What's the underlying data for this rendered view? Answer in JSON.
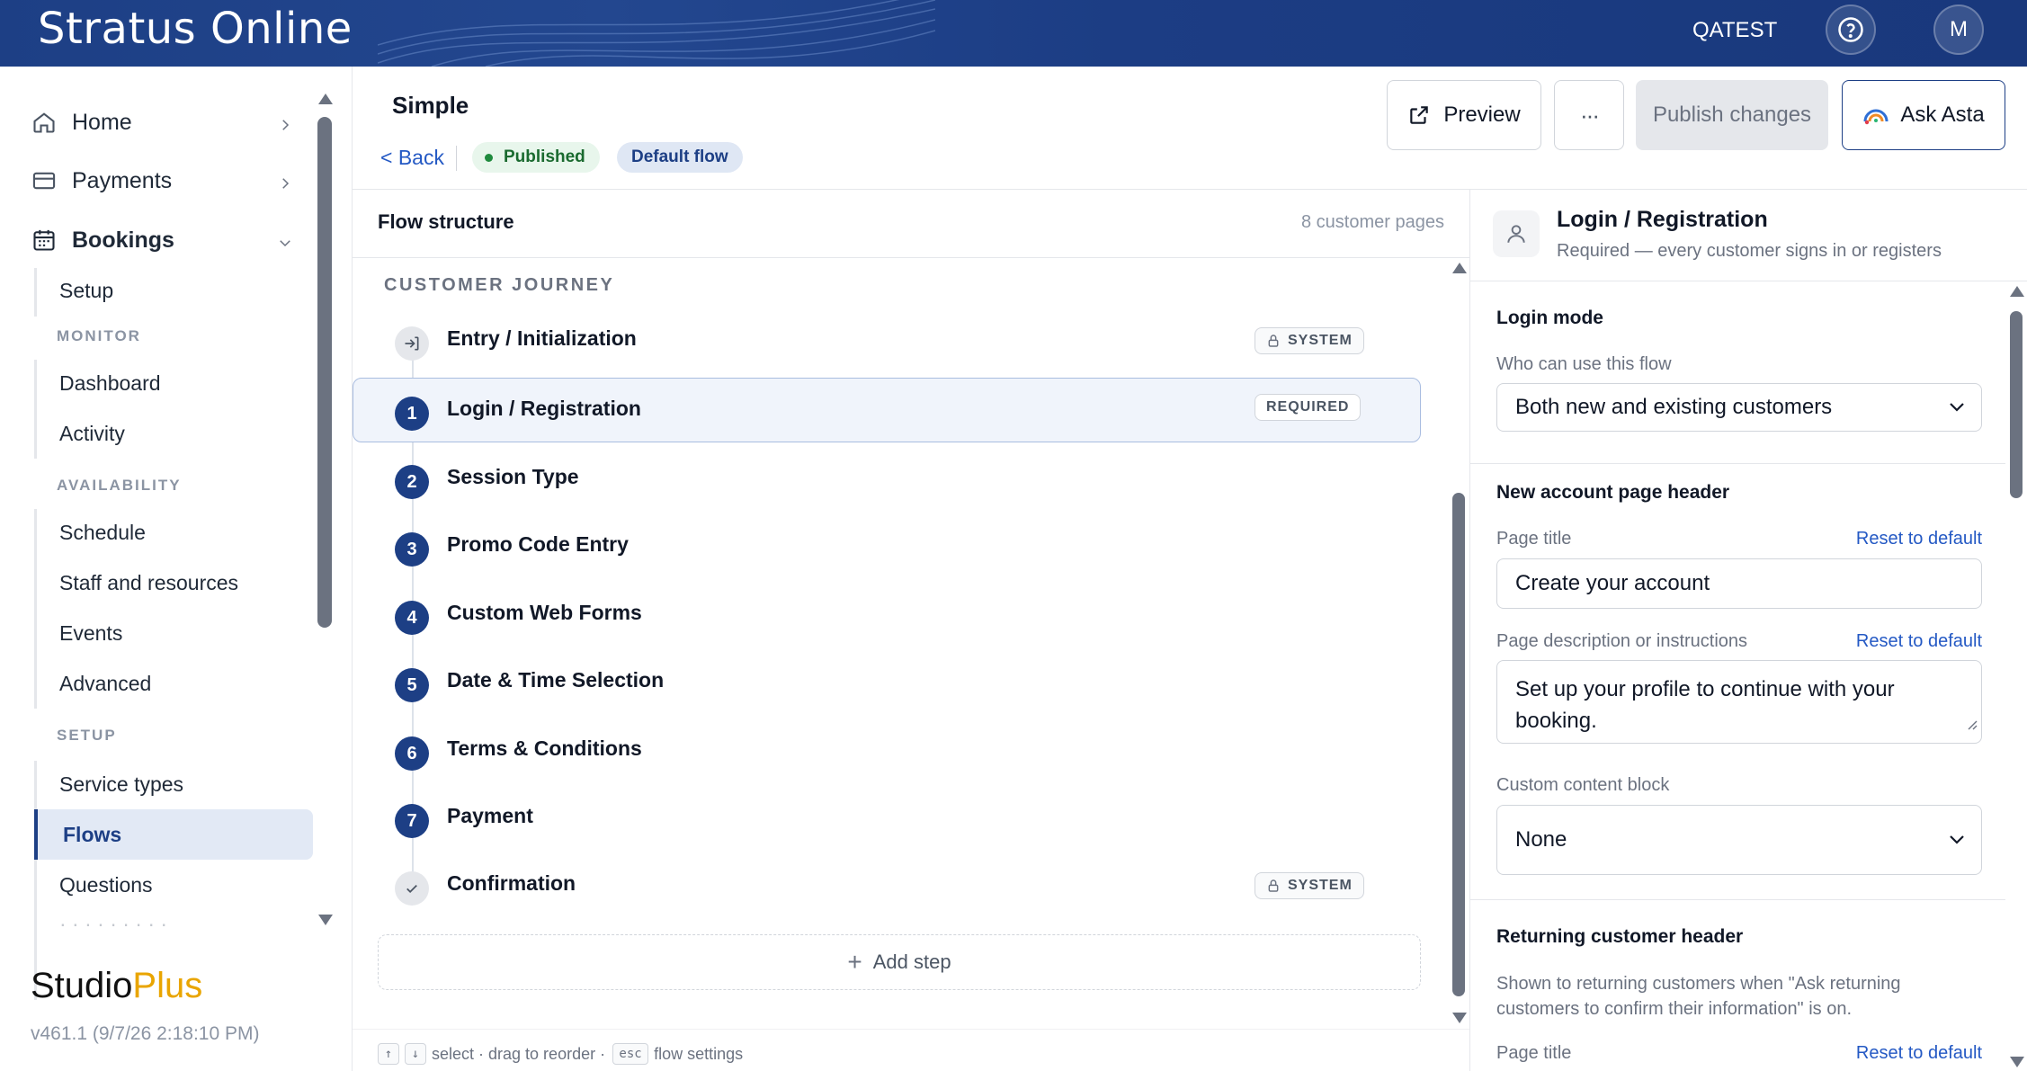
{
  "app": {
    "title": "Stratus Online",
    "org": "QATEST",
    "avatar_initial": "M"
  },
  "sidebar": {
    "home": "Home",
    "payments": "Payments",
    "bookings": "Bookings",
    "setup_item": "Setup",
    "sections": {
      "monitor": "MONITOR",
      "availability": "AVAILABILITY",
      "setup": "SETUP"
    },
    "monitor_items": [
      "Dashboard",
      "Activity"
    ],
    "availability_items": [
      "Schedule",
      "Staff and resources",
      "Events",
      "Advanced"
    ],
    "setup_items": [
      "Service types",
      "Flows",
      "Questions"
    ],
    "active_item": "Flows",
    "brand_studio": "Studio",
    "brand_plus": "Plus",
    "version": "v461.1 (9/7/26 2:18:10 PM)"
  },
  "header": {
    "title": "Simple",
    "back": "< Back",
    "status": "Published",
    "flow_badge": "Default flow",
    "preview": "Preview",
    "more": "···",
    "publish": "Publish changes",
    "ask": "Ask Asta"
  },
  "flow": {
    "title": "Flow structure",
    "count": "8 customer pages",
    "journey_label": "CUSTOMER JOURNEY",
    "steps": [
      {
        "num": "",
        "label": "Entry / Initialization",
        "tag": "SYSTEM",
        "icon": "enter-icon"
      },
      {
        "num": "1",
        "label": "Login / Registration",
        "tag": "REQUIRED"
      },
      {
        "num": "2",
        "label": "Session Type"
      },
      {
        "num": "3",
        "label": "Promo Code Entry"
      },
      {
        "num": "4",
        "label": "Custom Web Forms"
      },
      {
        "num": "5",
        "label": "Date & Time Selection"
      },
      {
        "num": "6",
        "label": "Terms & Conditions"
      },
      {
        "num": "7",
        "label": "Payment"
      },
      {
        "num": "",
        "label": "Confirmation",
        "tag": "SYSTEM",
        "icon": "check-icon"
      }
    ],
    "selected_step": "Login / Registration",
    "add_step": "Add step",
    "hints": {
      "k_up": "↑",
      "k_down": "↓",
      "select": "select · drag to reorder ·",
      "k_esc": "esc",
      "settings": "flow settings"
    }
  },
  "panel": {
    "title": "Login / Registration",
    "subtitle": "Required — every customer signs in or registers",
    "login_mode": "Login mode",
    "who_label": "Who can use this flow",
    "who_value": "Both new and existing customers",
    "new_header": "New account page header",
    "page_title_label": "Page title",
    "reset": "Reset to default",
    "page_title_value": "Create your account",
    "desc_label": "Page description or instructions",
    "desc_value": "Set up your profile to continue with your booking.",
    "custom_block_label": "Custom content block",
    "custom_block_value": "None",
    "returning_header": "Returning customer header",
    "returning_help": "Shown to returning customers when \"Ask returning customers to confirm their information\" is on.",
    "returning_page_title_label": "Page title"
  },
  "colors": {
    "brand": "#1d3f85",
    "accent_link": "#2459c4",
    "published": "#1f8a3d",
    "logo_plus": "#e9a500"
  }
}
